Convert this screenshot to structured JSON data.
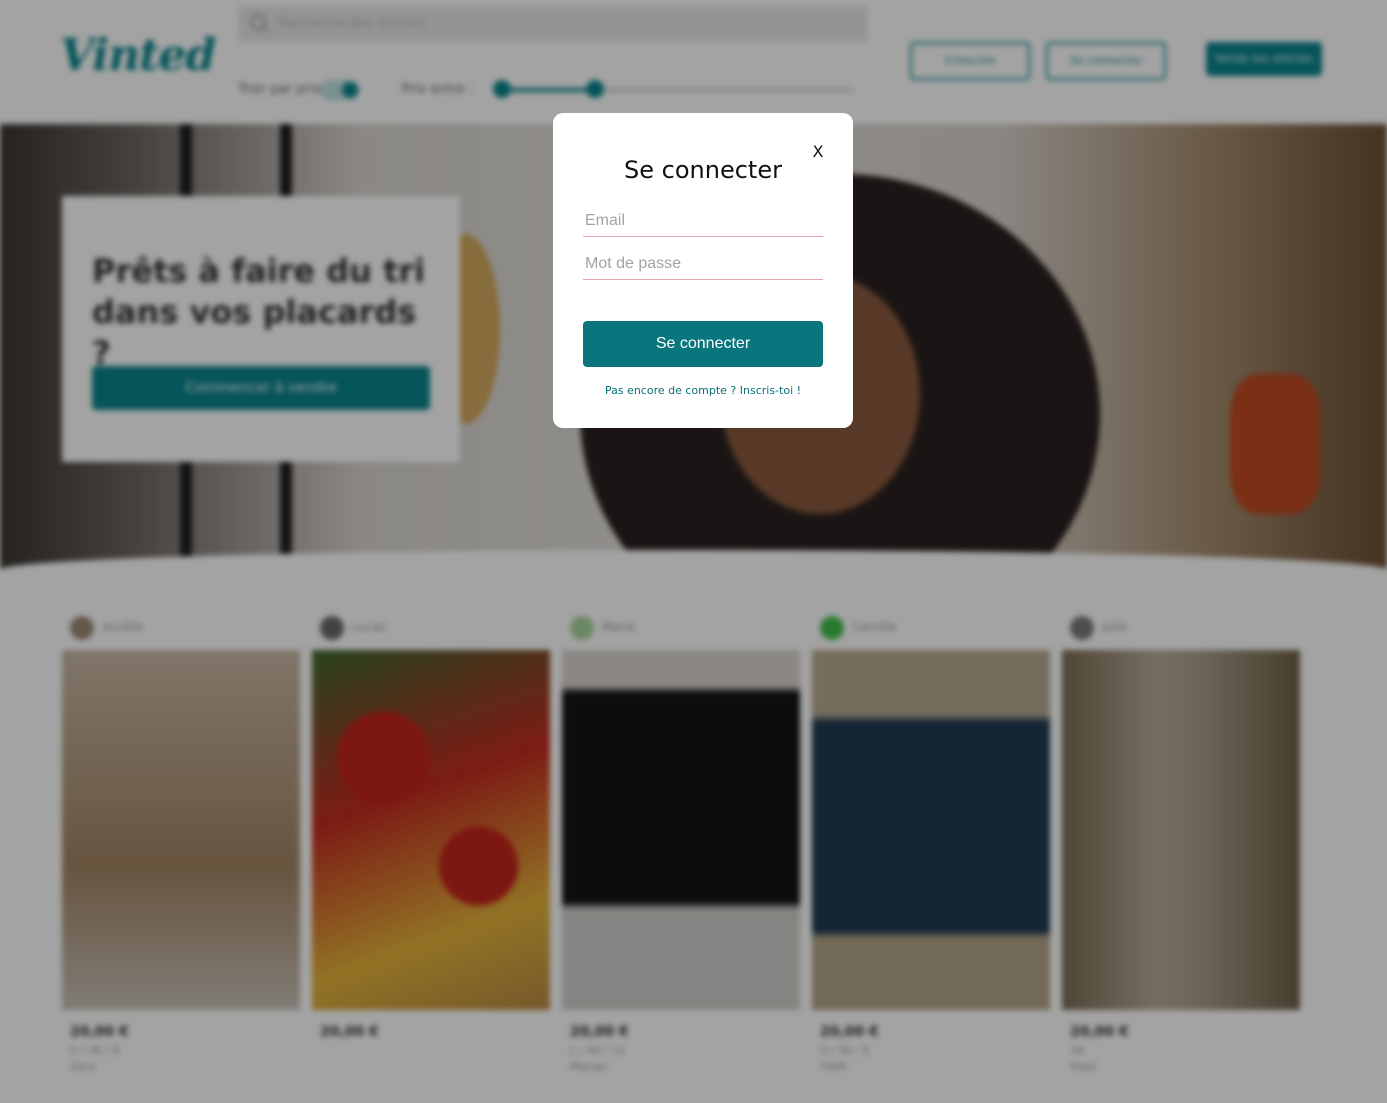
{
  "header": {
    "logo": "Vinted",
    "search_placeholder": "Recherche des articles",
    "sort_label": "Trier par prix :",
    "price_label": "Prix entre :",
    "price_range": [
      10,
      100
    ],
    "signup_label": "S'inscrire",
    "login_label": "Se connecter",
    "sell_label": "Vends tes articles",
    "accent_color": "#09858d"
  },
  "hero": {
    "title": "Prêts à faire du tri dans vos placards ?",
    "cta_label": "Commencer à vendre"
  },
  "offers": [
    {
      "owner": "Aurélie",
      "price": "20,00 €",
      "size": "S / 36 / 8",
      "brand": "Zara"
    },
    {
      "owner": "Lucas",
      "price": "20,00 €",
      "size": "",
      "brand": ""
    },
    {
      "owner": "Marie",
      "price": "20,00 €",
      "size": "L / 40 / 12",
      "brand": "Mango"
    },
    {
      "owner": "Camille",
      "price": "20,00 €",
      "size": "S / 36 / 8",
      "brand": "H&M"
    },
    {
      "owner": "Julie",
      "price": "20,00 €",
      "size": "38",
      "brand": "Kiabi"
    }
  ],
  "modal": {
    "close_label": "X",
    "title": "Se connecter",
    "email_placeholder": "Email",
    "password_placeholder": "Mot de passe",
    "submit_label": "Se connecter",
    "signup_link": "Pas encore de compte ? Inscris-toi !",
    "button_color": "#09767e"
  }
}
